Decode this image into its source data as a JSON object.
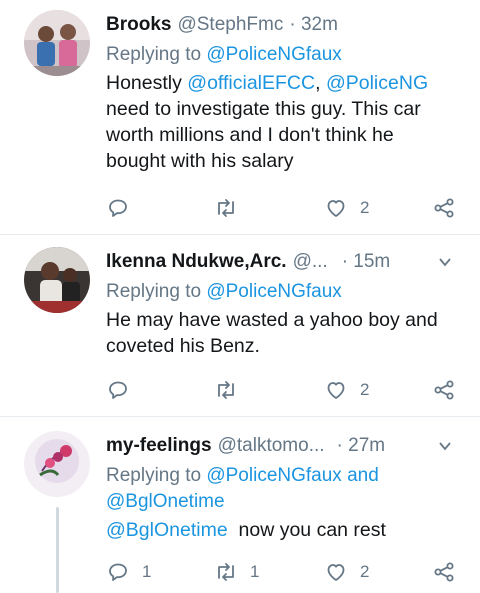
{
  "tweets": [
    {
      "name": "Brooks",
      "handle": "@StephFmc",
      "time": "· 32m",
      "replying_prefix": "Replying to ",
      "replying_to": "@PoliceNGfaux",
      "body_lines": [
        {
          "pre": "Honestly ",
          "m1": "@officialEFCC",
          "mid": ", ",
          "m2": "@PoliceNG"
        },
        "need to investigate this guy. This car",
        "worth millions and I don't think he",
        "bought with his salary"
      ],
      "reply_count": "",
      "retweet_count": "",
      "like_count": "2"
    },
    {
      "name": "Ikenna Ndukwe,Arc.",
      "handle": "@...",
      "time": "· 15m",
      "replying_prefix": "Replying to ",
      "replying_to": "@PoliceNGfaux",
      "body_lines": [
        "He may have wasted a yahoo boy and",
        "coveted his Benz."
      ],
      "reply_count": "",
      "retweet_count": "",
      "like_count": "2"
    },
    {
      "name": "my-feelings",
      "handle": "@talktomo...",
      "time": "· 27m",
      "replying_prefix": "Replying to ",
      "replying_to": "@PoliceNGfaux",
      "replying_and": " and",
      "replying_to_2": "@BglOnetime",
      "body_mention": "@BglOnetime",
      "body_rest": "  now you can rest",
      "reply_count": "1",
      "retweet_count": "1",
      "like_count": "2"
    }
  ],
  "icons": {
    "reply": "reply-icon",
    "retweet": "retweet-icon",
    "like": "heart-icon",
    "share": "share-icon",
    "more": "chevron-down-icon"
  },
  "colors": {
    "link": "#1b95e0",
    "muted": "#657786",
    "text": "#14171a",
    "divider": "#e6ecf0"
  }
}
